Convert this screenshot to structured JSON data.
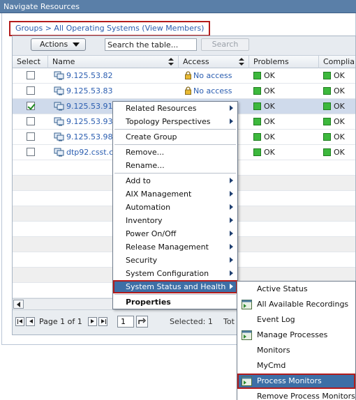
{
  "panel": {
    "title": "Navigate Resources"
  },
  "breadcrumb": {
    "text": "Groups > All Operating Systems (View Members)"
  },
  "toolbar": {
    "actions_label": "Actions",
    "search_placeholder": "Search the table...",
    "search_button": "Search"
  },
  "table": {
    "columns": [
      "Select",
      "Name",
      "Access",
      "Problems",
      "Complia"
    ],
    "rows": [
      {
        "name": "9.125.53.82",
        "access": "No access",
        "problems": "OK",
        "compliance": "OK",
        "checked": false
      },
      {
        "name": "9.125.53.83",
        "access": "No access",
        "problems": "OK",
        "compliance": "OK",
        "checked": false
      },
      {
        "name": "9.125.53.91",
        "access": "",
        "problems": "OK",
        "compliance": "OK",
        "checked": true
      },
      {
        "name": "9.125.53.93",
        "access": "",
        "problems": "OK",
        "compliance": "OK",
        "checked": false
      },
      {
        "name": "9.125.53.98",
        "access": "",
        "problems": "OK",
        "compliance": "OK",
        "checked": false
      },
      {
        "name": "dtp92.csst.c",
        "access": "",
        "problems": "OK",
        "compliance": "OK",
        "checked": false
      }
    ]
  },
  "pager": {
    "page_label": "Page 1 of 1",
    "page_value": "1",
    "selected_label": "Selected: 1",
    "total_label": "Tot"
  },
  "context_menu": {
    "related_resources": "Related Resources",
    "topology_perspectives": "Topology Perspectives",
    "create_group": "Create Group",
    "remove": "Remove...",
    "rename": "Rename...",
    "add_to": "Add to",
    "aix_management": "AIX Management",
    "automation": "Automation",
    "inventory": "Inventory",
    "power_on_off": "Power On/Off",
    "release_management": "Release Management",
    "security": "Security",
    "system_configuration": "System Configuration",
    "system_status_and_health": "System Status and Health",
    "properties": "Properties"
  },
  "submenu": {
    "active_status": "Active Status",
    "all_available_recordings": "All Available Recordings",
    "event_log": "Event Log",
    "manage_processes": "Manage Processes",
    "monitors": "Monitors",
    "mycmd": "MyCmd",
    "process_monitors": "Process Monitors",
    "remove_process_monitors": "Remove Process Monitors"
  },
  "colors": {
    "accent": "#3d6fa6",
    "highlight_border": "#b31b1b",
    "ok_green": "#3db83d",
    "link": "#2a5db0"
  }
}
